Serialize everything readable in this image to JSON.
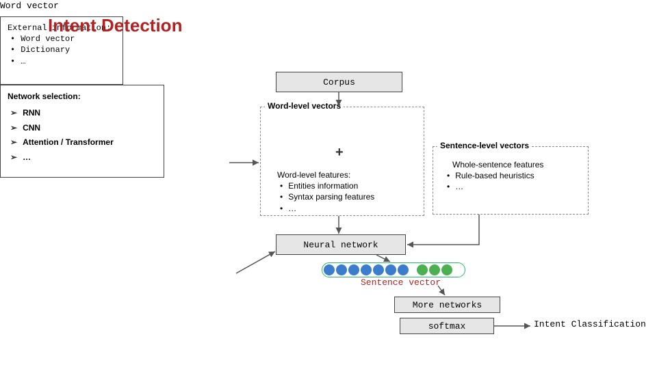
{
  "title": "Intent Detection",
  "boxes": {
    "corpus": "Corpus",
    "word_vector": "Word vector",
    "neural_network": "Neural network",
    "more_networks": "More networks",
    "softmax": "softmax",
    "sentence_vector": "Sentence vector"
  },
  "groups": {
    "word_level": {
      "title": "Word-level vectors",
      "features_heading": "Word-level features:",
      "features": [
        "Entities information",
        "Syntax parsing features",
        "…"
      ]
    },
    "sentence_level": {
      "title": "Sentence-level vectors",
      "features_heading": "Whole-sentence features",
      "features": [
        "Rule-based heuristics",
        "…"
      ]
    },
    "external": {
      "heading": "External information:",
      "items": [
        "Word vector",
        "Dictionary",
        "…"
      ]
    },
    "network_selection": {
      "heading": "Network selection:",
      "items": [
        "RNN",
        "CNN",
        "Attention / Transformer",
        "…"
      ]
    }
  },
  "output_label": "Intent Classification",
  "plus": "+"
}
